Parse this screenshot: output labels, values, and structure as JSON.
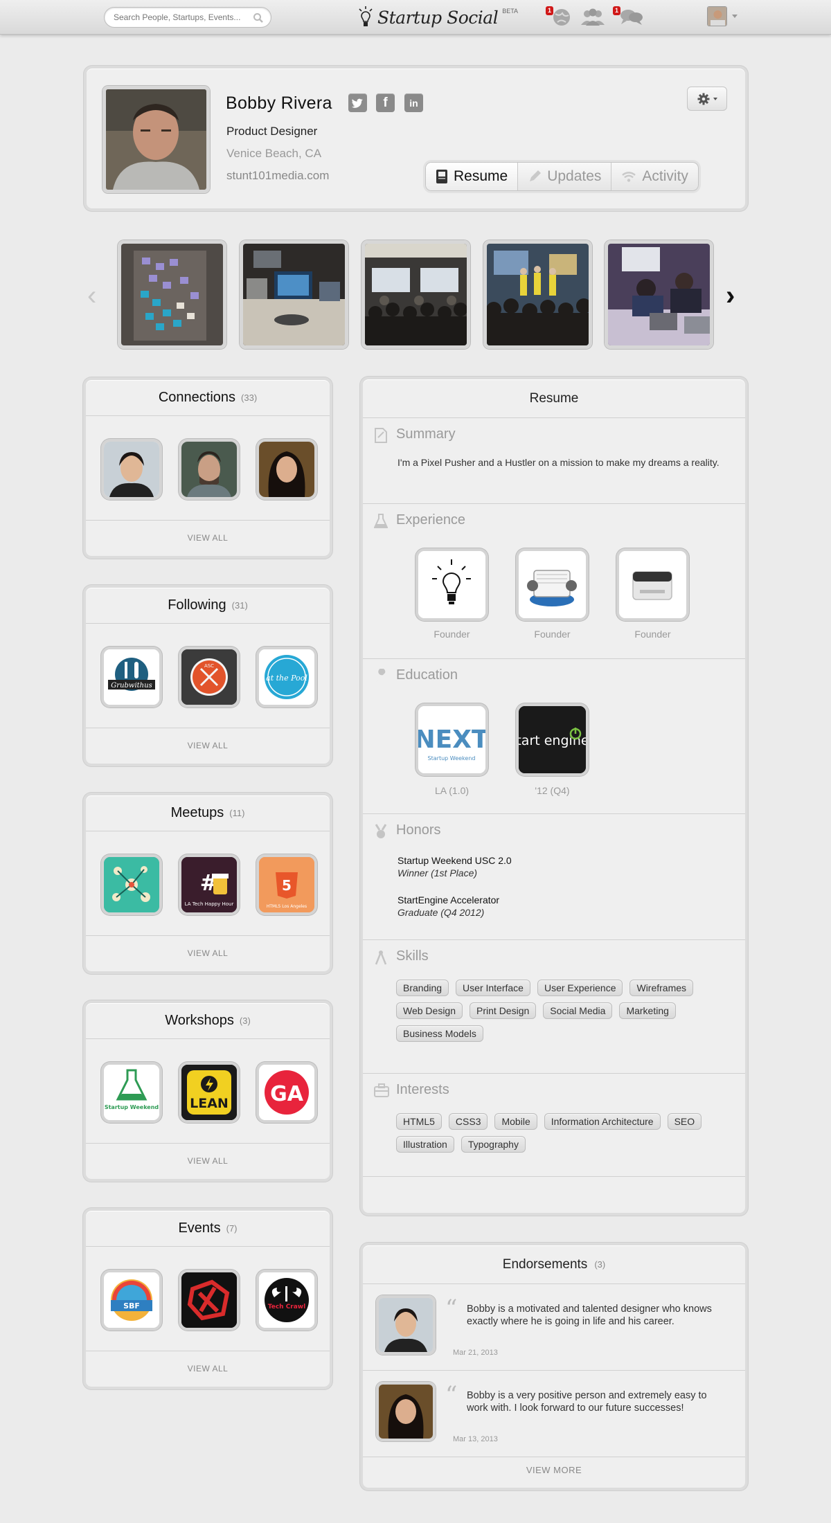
{
  "header": {
    "search_placeholder": "Search People, Startups, Events...",
    "logo_text": "Startup Social",
    "beta": "BETA",
    "notifications": {
      "globe_badge": "1",
      "messages_badge": "1"
    }
  },
  "profile": {
    "name": "Bobby Rivera",
    "title": "Product Designer",
    "location": "Venice Beach, CA",
    "website": "stunt101media.com",
    "social": [
      "twitter",
      "facebook",
      "linkedin"
    ],
    "tabs": [
      {
        "label": "Resume",
        "active": true
      },
      {
        "label": "Updates",
        "active": false
      },
      {
        "label": "Activity",
        "active": false
      }
    ]
  },
  "sidebar": {
    "connections": {
      "title": "Connections",
      "count": "(33)",
      "view_all": "VIEW ALL"
    },
    "following": {
      "title": "Following",
      "count": "(31)",
      "view_all": "VIEW ALL",
      "items": [
        "Grubwithus",
        "ASC",
        "at the Pool"
      ]
    },
    "meetups": {
      "title": "Meetups",
      "count": "(11)",
      "view_all": "VIEW ALL",
      "items": [
        "",
        "LA Tech Happy Hour",
        "HTML5 Los Angeles"
      ]
    },
    "workshops": {
      "title": "Workshops",
      "count": "(3)",
      "view_all": "VIEW ALL",
      "items": [
        "Startup Weekend",
        "LEAN",
        "GA"
      ]
    },
    "events": {
      "title": "Events",
      "count": "(7)",
      "view_all": "VIEW ALL",
      "items": [
        "SBF",
        "",
        "Tech Crawl"
      ]
    }
  },
  "resume": {
    "title": "Resume",
    "summary": {
      "heading": "Summary",
      "text": "I'm a Pixel Pusher and a Hustler on a mission to make my dreams a reality."
    },
    "experience": {
      "heading": "Experience",
      "items": [
        {
          "label": "Founder"
        },
        {
          "label": "Founder"
        },
        {
          "label": "Founder"
        }
      ]
    },
    "education": {
      "heading": "Education",
      "items": [
        {
          "label": "LA (1.0)",
          "logo_text": "NEXT",
          "logo_sub": "Startup Weekend"
        },
        {
          "label": "'12  (Q4)",
          "logo_text": "start engine"
        }
      ]
    },
    "honors": {
      "heading": "Honors",
      "items": [
        {
          "title": "Startup Weekend USC 2.0",
          "subtitle": "Winner (1st Place)"
        },
        {
          "title": "StartEngine Accelerator",
          "subtitle": "Graduate (Q4 2012)"
        }
      ]
    },
    "skills": {
      "heading": "Skills",
      "tags": [
        "Branding",
        "User Interface",
        "User Experience",
        "Wireframes",
        "Web Design",
        "Print Design",
        "Social Media",
        "Marketing",
        "Business Models"
      ]
    },
    "interests": {
      "heading": "Interests",
      "tags": [
        "HTML5",
        "CSS3",
        "Mobile",
        "Information Architecture",
        "SEO",
        "Illustration",
        "Typography"
      ]
    }
  },
  "endorsements": {
    "title": "Endorsements",
    "count": "(3)",
    "items": [
      {
        "text": "Bobby is a motivated and talented designer who knows exactly where he is going in life and his career.",
        "date": "Mar 21, 2013"
      },
      {
        "text": "Bobby is a very positive person and extremely easy to work with. I look forward to our future successes!",
        "date": "Mar 13, 2013"
      }
    ],
    "view_more": "VIEW MORE"
  }
}
